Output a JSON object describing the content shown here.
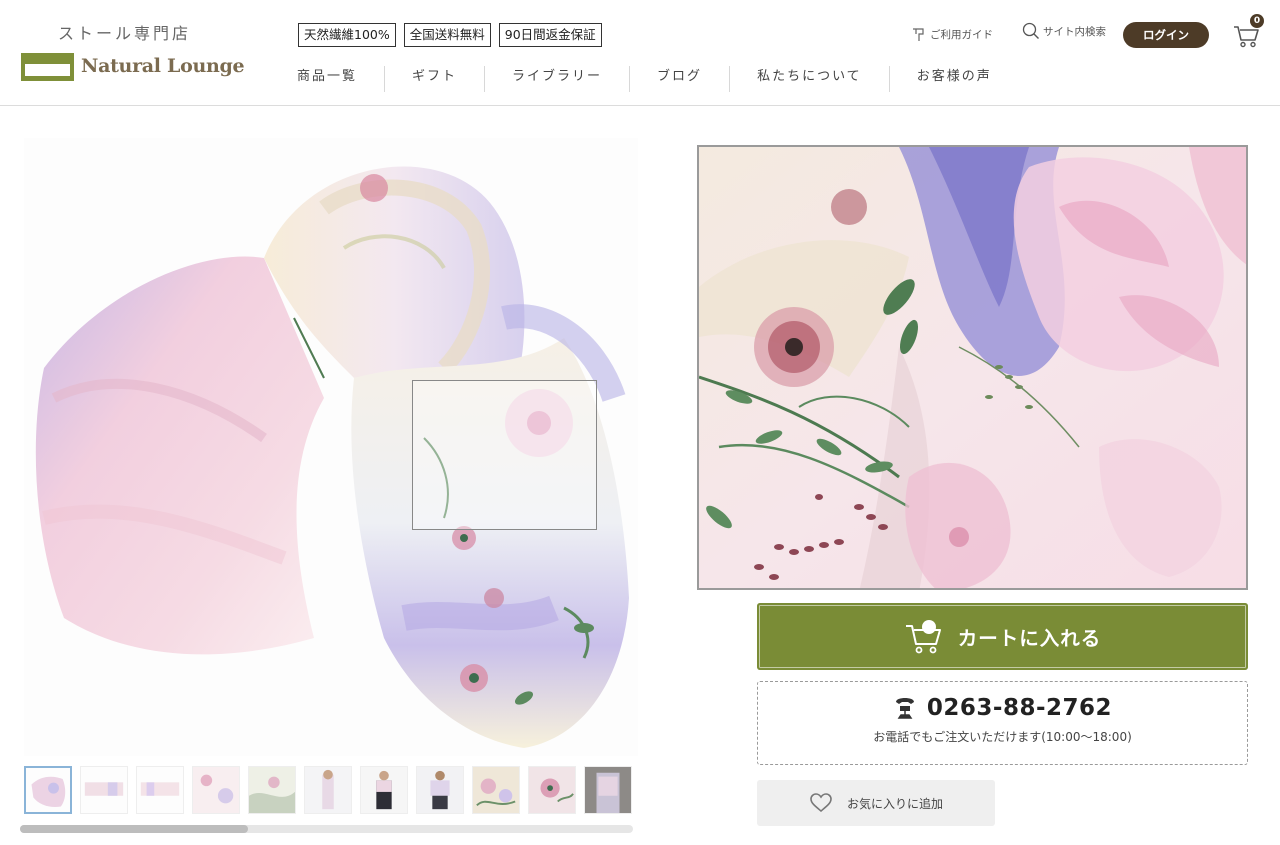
{
  "header": {
    "tagline": "ストール専門店",
    "brand": "Natural Lounge",
    "badges": [
      "天然繊維100%",
      "全国送料無料",
      "90日間返金保証"
    ],
    "nav": [
      "商品一覧",
      "ギフト",
      "ライブラリー",
      "ブログ",
      "私たちについて",
      "お客様の声"
    ],
    "guide_label": "ご利用ガイド",
    "search_label": "サイト内検索",
    "login_label": "ログイン",
    "cart_count": "0"
  },
  "gallery": {
    "thumbnail_count": 11,
    "active_thumbnail": 1
  },
  "purchase": {
    "cart_label": "カートに入れる",
    "phone": "0263-88-2762",
    "phone_note": "お電話でもご注文いただけます(10:00〜18:00)",
    "favorite_label": "お気に入りに追加"
  },
  "colors": {
    "brand_green": "#7f9039",
    "cart_green": "#7a8c36",
    "dark_brown": "#4d3b27"
  }
}
